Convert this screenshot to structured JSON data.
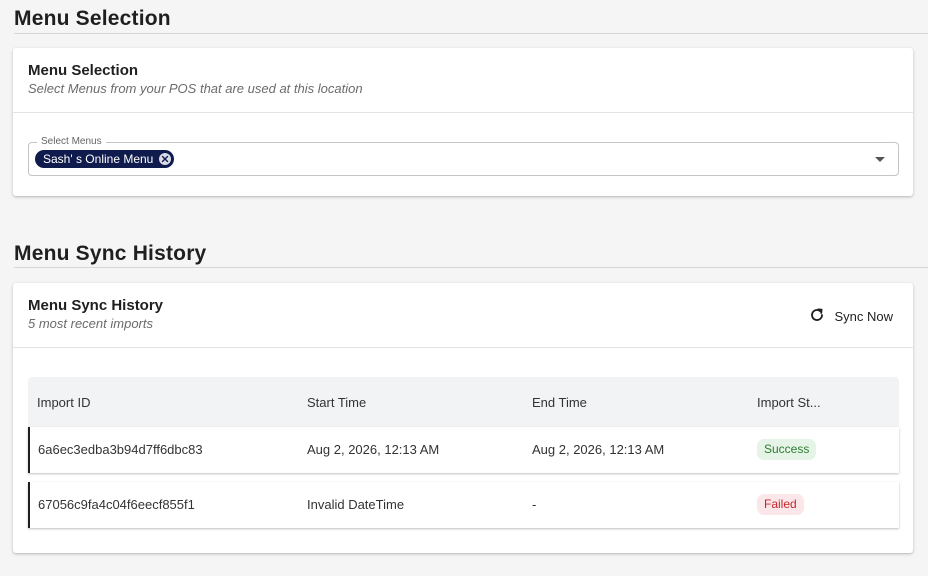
{
  "menu_section": {
    "heading": "Menu Selection",
    "card_title": "Menu Selection",
    "card_subtitle": "Select Menus from your POS that are used at this location",
    "select": {
      "label": "Select Menus",
      "chips": [
        {
          "label": "Sash' s Online Menu",
          "icon": "close-circle-icon"
        }
      ],
      "caret_icon": "chevron-down-icon"
    }
  },
  "sync_section": {
    "heading": "Menu Sync History",
    "card_title": "Menu Sync History",
    "card_subtitle": "5 most recent imports",
    "sync_button": {
      "label": "Sync Now",
      "icon": "refresh-icon"
    },
    "table": {
      "columns": [
        "Import ID",
        "Start Time",
        "End Time",
        "Import St..."
      ],
      "rows": [
        {
          "import_id": "6a6ec3edba3b94d7ff6dbc83",
          "start_time": "Aug 2, 2026, 12:13 AM",
          "end_time": "Aug 2, 2026, 12:13 AM",
          "status": "Success",
          "status_color": "#2e7d32"
        },
        {
          "import_id": "67056c9fa4c04f6eecf855f1",
          "start_time": "Invalid DateTime",
          "end_time": "-",
          "status": "Failed",
          "status_color": "#c62828"
        }
      ]
    }
  },
  "colors": {
    "chip_bg": "#0f1b4c",
    "page_bg": "#f5f5f5"
  }
}
